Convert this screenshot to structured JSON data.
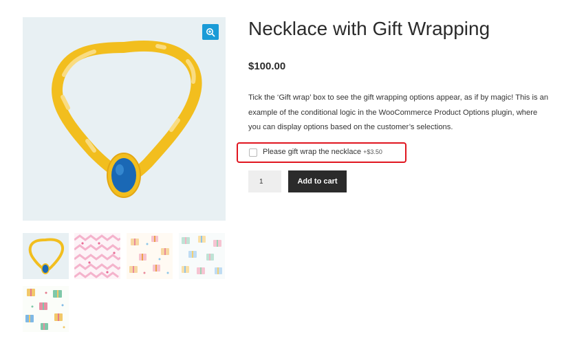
{
  "product": {
    "title": "Necklace with Gift Wrapping",
    "price": "$100.00",
    "description": "Tick the ‘Gift wrap’ box to see the gift wrapping options appear, as if by magic! This is an example of the conditional logic in the WooCommerce Product Options plugin, where you can display options based on the customer’s selections."
  },
  "option": {
    "label": "Please gift wrap the necklace",
    "price": "+$3.50",
    "checked": false
  },
  "cart": {
    "quantity": "1",
    "add_label": "Add to cart"
  },
  "gallery": {
    "zoom_icon": "zoom-in-icon",
    "thumbnails": [
      "necklace",
      "pink-hearts-pattern",
      "bows-pattern",
      "gifts-pattern",
      "presents-pattern"
    ]
  },
  "colors": {
    "gold": "#f2be1e",
    "gem": "#1a68b5",
    "zoom": "#1a9bd7",
    "highlight": "#e0141e",
    "button": "#2b2b2b"
  }
}
